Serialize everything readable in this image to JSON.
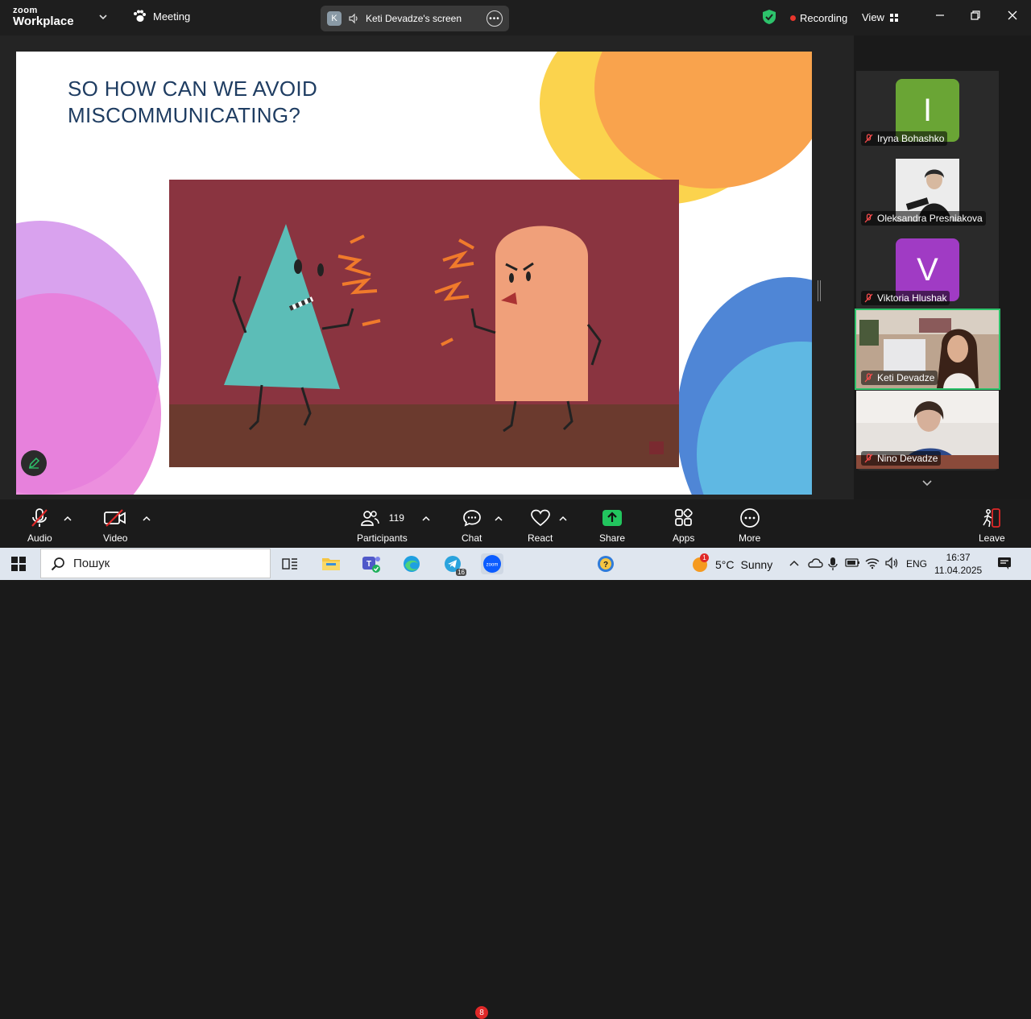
{
  "app": {
    "logo_line1": "zoom",
    "logo_line2": "Workplace",
    "meeting_label": "Meeting",
    "share_pill": {
      "initial": "K",
      "text": "Keti Devadze's screen"
    },
    "recording_label": "Recording",
    "view_label": "View"
  },
  "slide": {
    "title_line1": "SO HOW CAN WE AVOID",
    "title_line2": "MISCOMMUNICATING?"
  },
  "participants": [
    {
      "name": "Iryna Bohashko",
      "initial": "I",
      "avatar_color": "#6aa535",
      "muted": true
    },
    {
      "name": "Oleksandra Presniakova",
      "initial": "",
      "avatar_color": "#d9d9d9",
      "muted": true
    },
    {
      "name": "Viktoria Hlushak",
      "initial": "V",
      "avatar_color": "#a03bc4",
      "muted": true
    },
    {
      "name": "Keti Devadze",
      "initial": "",
      "avatar_color": "#8a6a55",
      "muted": true,
      "active": true
    },
    {
      "name": "Nino Devadze",
      "initial": "",
      "avatar_color": "#c9b9a8",
      "muted": true
    }
  ],
  "toolbar": {
    "audio": "Audio",
    "video": "Video",
    "participants": "Participants",
    "participants_count": "119",
    "chat": "Chat",
    "chat_badge": "8",
    "react": "React",
    "share": "Share",
    "apps": "Apps",
    "more": "More",
    "leave": "Leave"
  },
  "taskbar": {
    "search_placeholder": "Пошук",
    "telegram_badge": "16",
    "weather_temp": "5°C",
    "weather_text": "Sunny",
    "weather_badge": "1",
    "language": "ENG",
    "time": "16:37",
    "date": "11.04.2025"
  },
  "colors": {
    "green_accent": "#2dc26b",
    "share_green": "#22c55e",
    "record_red": "#e8362c",
    "title_blue": "#1f3d62"
  }
}
